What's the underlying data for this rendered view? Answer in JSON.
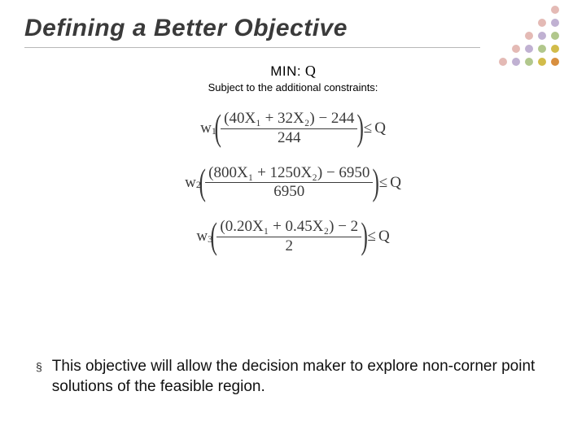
{
  "title": "Defining a Better Objective",
  "objective": {
    "label": "MIN:",
    "var": "Q"
  },
  "subject": "Subject to the additional constraints:",
  "constraints": [
    {
      "w": "w",
      "wi": "1",
      "num": "(40X₁ + 32X₂) − 244",
      "den": "244",
      "op": "≤",
      "rhs": "Q"
    },
    {
      "w": "w",
      "wi": "2",
      "num": "(800X₁ + 1250X₂) − 6950",
      "den": "6950",
      "op": "≤",
      "rhs": "Q"
    },
    {
      "w": "w",
      "wi": "3",
      "num": "(0.20X₁ + 0.45X₂) − 2",
      "den": "2",
      "op": "≤",
      "rhs": "Q"
    }
  ],
  "bullet": {
    "mark": "§",
    "text": "This objective will allow the decision maker to explore non-corner point solutions of the feasible region."
  },
  "dots": {
    "palette": [
      "#7a5aa0",
      "#7aa03c",
      "#c0a000",
      "#d07818",
      "#b33a2a"
    ]
  }
}
